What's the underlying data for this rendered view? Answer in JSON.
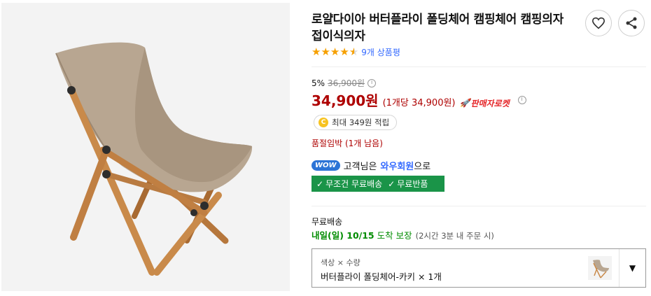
{
  "product": {
    "title": "로얄다이아 버터플라이 폴딩체어 캠핑체어 캠핑의자 접이식의자",
    "image_alt": "product-main-image",
    "rating": 4.5,
    "review_text": "9개 상품평"
  },
  "actions": {
    "wishlist_icon": "heart-icon",
    "share_icon": "share-icon"
  },
  "price": {
    "discount_rate": "5%",
    "original_price": "36,900원",
    "sale_price": "34,900원",
    "unit_price": "(1개당 34,900원)",
    "rocket_badge": "판매자로켓"
  },
  "points": {
    "coin_symbol": "C",
    "text": "최대 349원 적립"
  },
  "stock_note": "품절임박 (1개 남음)",
  "wow": {
    "badge": "WOW",
    "prefix": "고객님은",
    "member_type": "와우회원",
    "suffix": "으로"
  },
  "benefits": {
    "free_shipping": "무조건 무료배송",
    "free_return": "무료반품"
  },
  "shipping": {
    "label": "무료배송",
    "date": "내일(일) 10/15",
    "guarantee": "도착 보장",
    "note": "(2시간 3분 내 주문 시)"
  },
  "option": {
    "header": "색상 × 수량",
    "value": "버터플라이 폴딩체어-카키 × 1개",
    "caret_icon": "caret-down-icon"
  },
  "colors": {
    "price_red": "#ae0000",
    "wow_blue": "#346aff",
    "benefit_green": "#1a9448",
    "delivery_green": "#008c00",
    "star_orange": "#f6a000"
  }
}
